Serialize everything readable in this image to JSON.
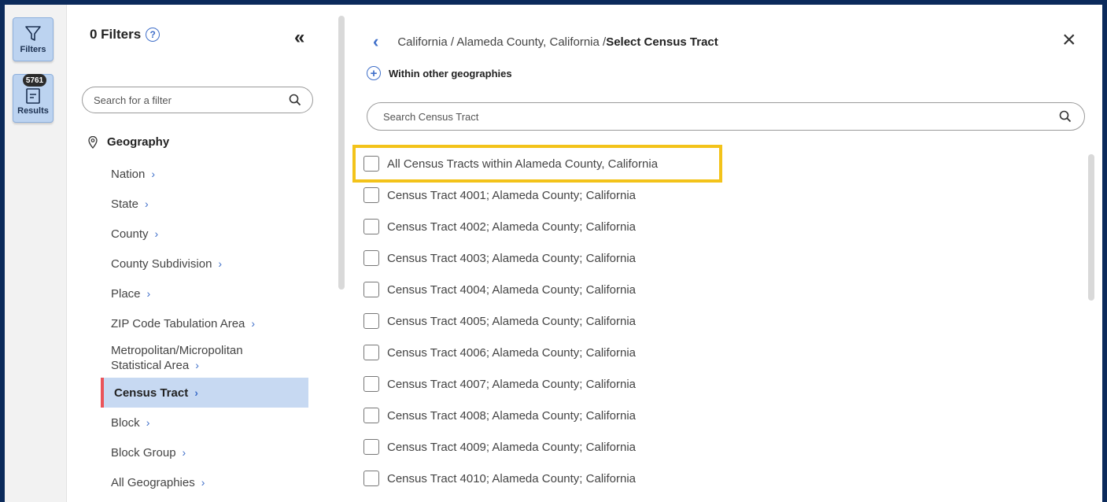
{
  "rail": {
    "filters_label": "Filters",
    "results_label": "Results",
    "results_count": "5761"
  },
  "filter_panel": {
    "title": "0 Filters",
    "search_placeholder": "Search for a filter",
    "geography_heading": "Geography",
    "items": [
      {
        "label": "Nation"
      },
      {
        "label": "State"
      },
      {
        "label": "County"
      },
      {
        "label": "County Subdivision"
      },
      {
        "label": "Place"
      },
      {
        "label": "ZIP Code Tabulation Area"
      },
      {
        "label_line1": "Metropolitan/Micropolitan",
        "label_line2": "Statistical Area"
      },
      {
        "label": "Census Tract"
      },
      {
        "label": "Block"
      },
      {
        "label": "Block Group"
      },
      {
        "label": "All Geographies"
      }
    ]
  },
  "main": {
    "breadcrumb_path": "California / Alameda County, California / ",
    "breadcrumb_current": "Select Census Tract",
    "within_label": "Within other geographies",
    "search_placeholder": "Search Census Tract",
    "tracts": [
      "All Census Tracts within Alameda County, California",
      "Census Tract 4001; Alameda County; California",
      "Census Tract 4002; Alameda County; California",
      "Census Tract 4003; Alameda County; California",
      "Census Tract 4004; Alameda County; California",
      "Census Tract 4005; Alameda County; California",
      "Census Tract 4006; Alameda County; California",
      "Census Tract 4007; Alameda County; California",
      "Census Tract 4008; Alameda County; California",
      "Census Tract 4009; Alameda County; California",
      "Census Tract 4010; Alameda County; California"
    ]
  },
  "colors": {
    "accent_blue": "#3f6fc9",
    "highlight_yellow": "#f3c31a",
    "active_marker": "#e9545a",
    "frame": "#0b2a5b"
  }
}
